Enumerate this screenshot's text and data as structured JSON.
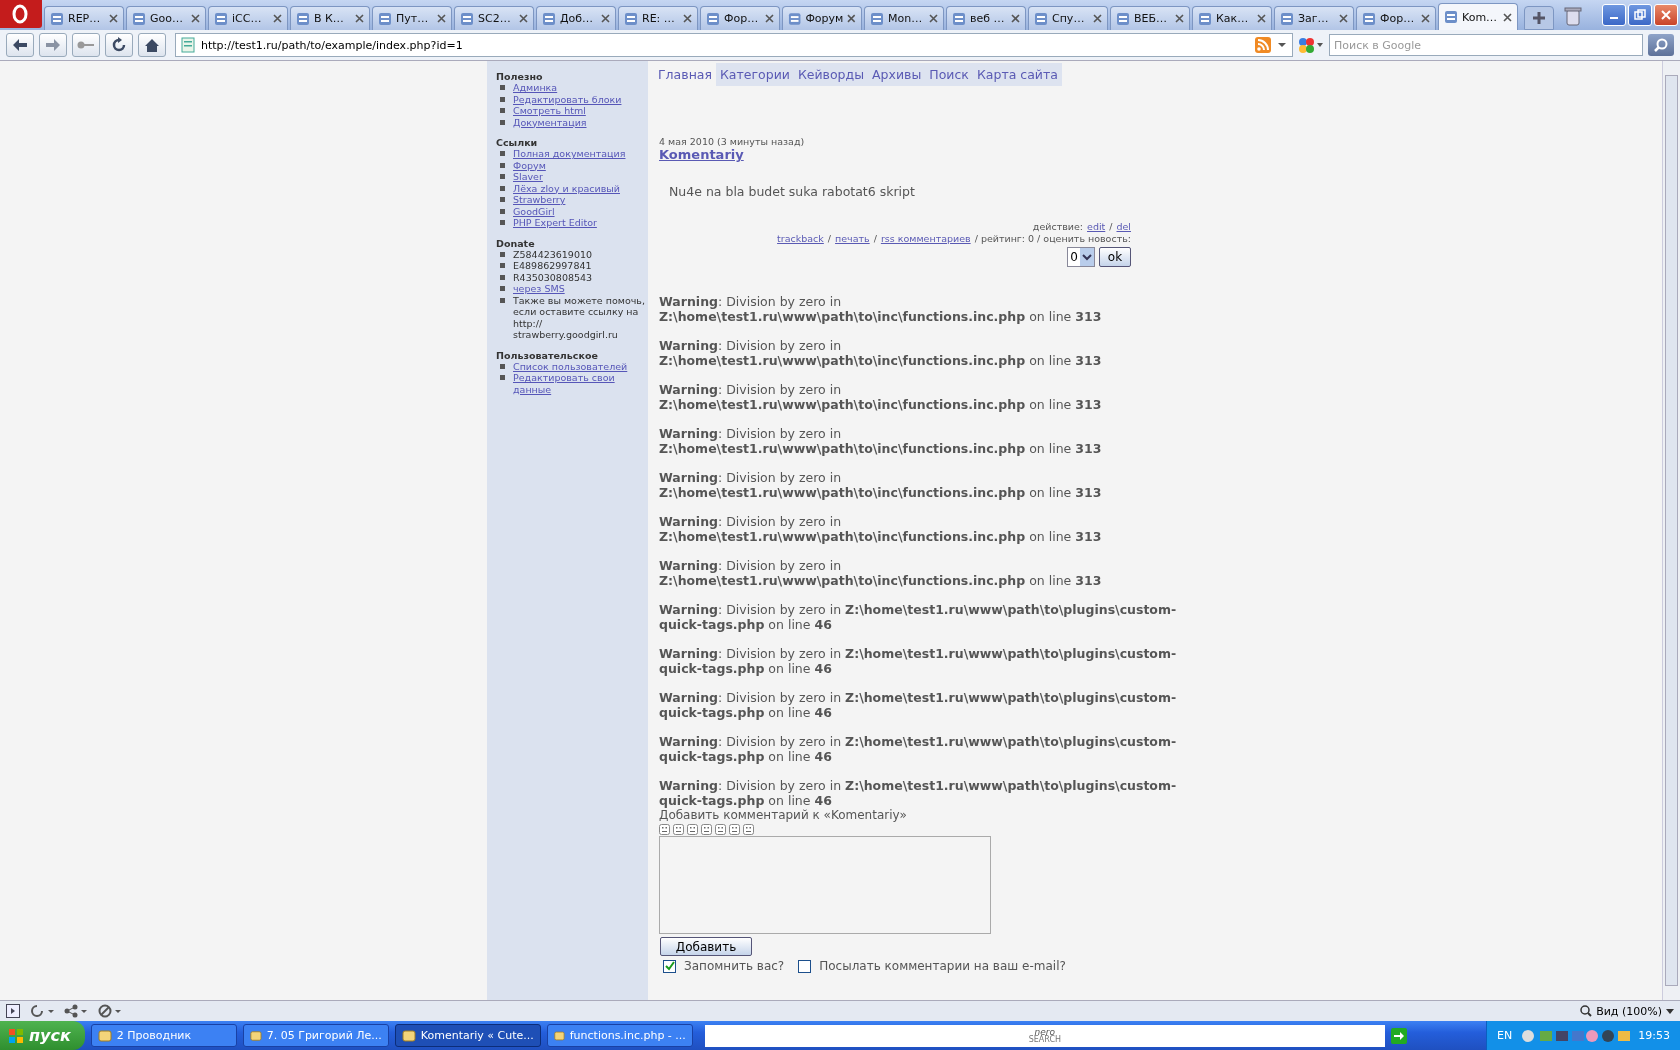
{
  "browser": {
    "tabs": [
      {
        "title": "REP…",
        "selected": false
      },
      {
        "title": "Goo…",
        "selected": false
      },
      {
        "title": "iCC…",
        "selected": false
      },
      {
        "title": "В К…",
        "selected": false
      },
      {
        "title": "Пут…",
        "selected": false
      },
      {
        "title": "SC2…",
        "selected": false
      },
      {
        "title": "Доб…",
        "selected": false
      },
      {
        "title": "RE: …",
        "selected": false
      },
      {
        "title": "Фор…",
        "selected": false
      },
      {
        "title": "Форум",
        "selected": false
      },
      {
        "title": "Mon…",
        "selected": false
      },
      {
        "title": "веб …",
        "selected": false
      },
      {
        "title": "Спу…",
        "selected": false
      },
      {
        "title": "ВЕБ…",
        "selected": false
      },
      {
        "title": "Как…",
        "selected": false
      },
      {
        "title": "Заг…",
        "selected": false
      },
      {
        "title": "Фор…",
        "selected": false
      },
      {
        "title": "Kom…",
        "selected": true
      }
    ],
    "address": "http://test1.ru/path/to/example/index.php?id=1",
    "search_placeholder": "Поиск в Google"
  },
  "sidebar": {
    "sections": [
      {
        "heading": "Полезно",
        "items": [
          {
            "text": "Админка",
            "kind": "link"
          },
          {
            "text": "Редактировать блоки",
            "kind": "link"
          },
          {
            "text": "Смотреть html",
            "kind": "link"
          },
          {
            "text": "Документация",
            "kind": "link"
          }
        ]
      },
      {
        "heading": "Ссылки",
        "items": [
          {
            "text": "Полная документация",
            "kind": "link"
          },
          {
            "text": "Форум",
            "kind": "link"
          },
          {
            "text": "Slaver",
            "kind": "link"
          },
          {
            "text": "Лёха zloy и красивый",
            "kind": "link"
          },
          {
            "text": "Strawberry",
            "kind": "link"
          },
          {
            "text": "GoodGirl",
            "kind": "link"
          },
          {
            "text": "PHP Expert Editor",
            "kind": "link"
          }
        ]
      },
      {
        "heading": "Donate",
        "items": [
          {
            "text": "Z584423619010",
            "kind": "text"
          },
          {
            "text": "E489862997841",
            "kind": "text"
          },
          {
            "text": "R435030808543",
            "kind": "text"
          },
          {
            "text": "через SMS",
            "kind": "link"
          },
          {
            "text": "Также вы можете помочь, если оставите ссылку на http:// strawberry.goodgirl.ru",
            "kind": "text"
          }
        ]
      },
      {
        "heading": "Пользовательское",
        "items": [
          {
            "text": "Список пользователей",
            "kind": "link"
          },
          {
            "text": "Редактировать свои данные",
            "kind": "link"
          }
        ]
      }
    ]
  },
  "nav": [
    {
      "label": "Главная",
      "selected": true
    },
    {
      "label": "Категории",
      "selected": false
    },
    {
      "label": "Кейворды",
      "selected": false
    },
    {
      "label": "Архивы",
      "selected": false
    },
    {
      "label": "Поиск",
      "selected": false
    },
    {
      "label": "Карта сайта",
      "selected": false
    }
  ],
  "post": {
    "date": "4 мая 2010 (3 минуты назад)",
    "title": "Komentariy",
    "body": "Nu4e na bla budet suka rabotat6 skript",
    "action_line": [
      {
        "text": "действие:",
        "kind": "text"
      },
      {
        "text": "edit",
        "kind": "link"
      },
      {
        "text": "/",
        "kind": "text"
      },
      {
        "text": "del",
        "kind": "link"
      }
    ],
    "meta_line": [
      {
        "text": "trackback",
        "kind": "link"
      },
      {
        "text": "/",
        "kind": "text"
      },
      {
        "text": "печать",
        "kind": "link"
      },
      {
        "text": "/",
        "kind": "text"
      },
      {
        "text": "rss комментариев",
        "kind": "link"
      },
      {
        "text": "/ рейтинг: 0 / оценить новость:",
        "kind": "text"
      }
    ],
    "rate_value": "0",
    "rate_button": "ok"
  },
  "warnings": [
    "**Warning**: Division by zero in **Z:\\home\\test1.ru\\www\\path\\to\\inc\\functions.inc.php** on line **313**",
    "**Warning**: Division by zero in **Z:\\home\\test1.ru\\www\\path\\to\\inc\\functions.inc.php** on line **313**",
    "**Warning**: Division by zero in **Z:\\home\\test1.ru\\www\\path\\to\\inc\\functions.inc.php** on line **313**",
    "**Warning**: Division by zero in **Z:\\home\\test1.ru\\www\\path\\to\\inc\\functions.inc.php** on line **313**",
    "**Warning**: Division by zero in **Z:\\home\\test1.ru\\www\\path\\to\\inc\\functions.inc.php** on line **313**",
    "**Warning**: Division by zero in **Z:\\home\\test1.ru\\www\\path\\to\\inc\\functions.inc.php** on line **313**",
    "**Warning**: Division by zero in **Z:\\home\\test1.ru\\www\\path\\to\\inc\\functions.inc.php** on line **313**",
    "**Warning**: Division by zero in **Z:\\home\\test1.ru\\www\\path\\to\\plugins\\custom-quick-tags.php** on line **46**",
    "**Warning**: Division by zero in **Z:\\home\\test1.ru\\www\\path\\to\\plugins\\custom-quick-tags.php** on line **46**",
    "**Warning**: Division by zero in **Z:\\home\\test1.ru\\www\\path\\to\\plugins\\custom-quick-tags.php** on line **46**",
    "**Warning**: Division by zero in **Z:\\home\\test1.ru\\www\\path\\to\\plugins\\custom-quick-tags.php** on line **46**",
    "**Warning**: Division by zero in **Z:\\home\\test1.ru\\www\\path\\to\\plugins\\custom-quick-tags.php** on line **46**"
  ],
  "comment_form": {
    "heading": "Добавить комментарий к «Komentariy»",
    "submit": "Добавить",
    "options": [
      {
        "label": "Запомнить вас?",
        "checked": true
      },
      {
        "label": "Посылать комментарии на ваш e-mail?",
        "checked": false
      }
    ]
  },
  "status_bar": {
    "zoom": "Вид (100%)"
  },
  "taskbar": {
    "start": "пуск",
    "tasks": [
      {
        "label": "2 Проводник",
        "selected": false
      },
      {
        "label": "7. 05 Григорий Ле...",
        "selected": false
      },
      {
        "label": "Komentariy « Cute...",
        "selected": true
      },
      {
        "label": "functions.inc.php - ...",
        "selected": false
      }
    ],
    "search_logo": "nero",
    "search_logo_sub": "SEARCH",
    "language": "EN",
    "clock": "19:53"
  }
}
